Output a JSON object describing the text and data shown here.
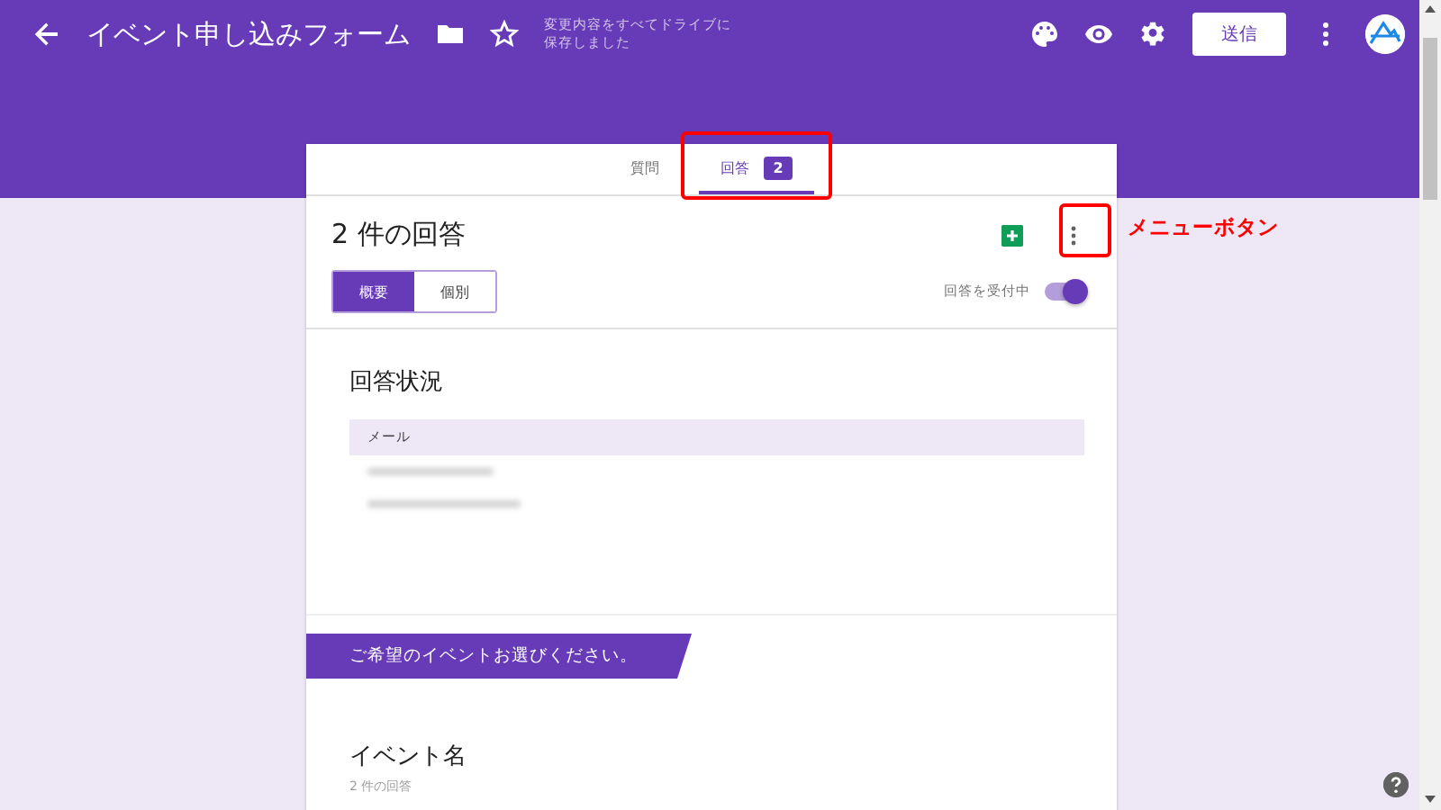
{
  "toolbar": {
    "title": "イベント申し込みフォーム",
    "save_status": [
      "変更内容をすべてドライブに",
      "保存しました"
    ],
    "send_button": "送信"
  },
  "tabs": [
    {
      "label": "質問",
      "selected": false
    },
    {
      "label": "回答",
      "selected": true,
      "badge": "2"
    }
  ],
  "responses": {
    "title": "2 件の回答",
    "view_toggle": [
      {
        "label": "概要",
        "selected": true
      },
      {
        "label": "個別",
        "selected": false
      }
    ],
    "accepting": {
      "label": "回答を受付中",
      "on": true
    }
  },
  "summary": {
    "title": "回答状況",
    "column": "メール"
  },
  "section": {
    "title": "ご希望のイベントお選びください。"
  },
  "question": {
    "title": "イベント名",
    "count": "2 件の回答"
  },
  "annotation": {
    "label": "メニューボタン"
  }
}
